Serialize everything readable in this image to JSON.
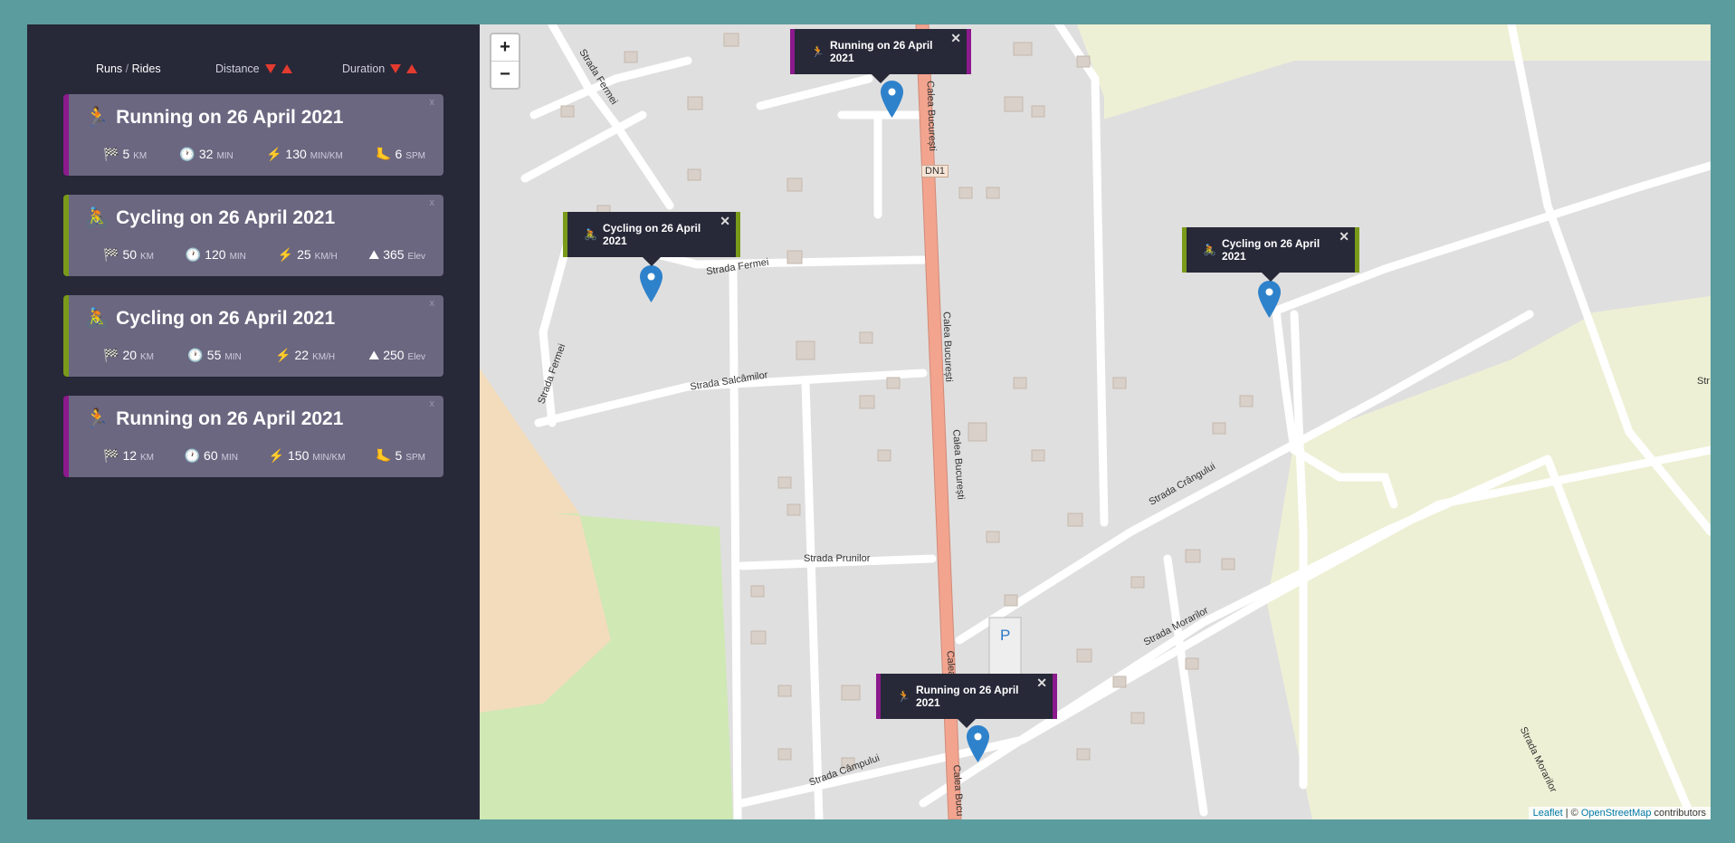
{
  "sidebar": {
    "sort": {
      "runs_label": "Runs",
      "sep": " / ",
      "rides_label": "Rides",
      "distance_label": "Distance",
      "duration_label": "Duration"
    },
    "workouts": [
      {
        "type": "running",
        "title": "Running on 26 April 2021",
        "close": "x",
        "icon": "runner-icon",
        "stats": [
          {
            "icon": "flag-icon",
            "value": "5",
            "unit": "KM"
          },
          {
            "icon": "clock-icon",
            "value": "32",
            "unit": "MIN"
          },
          {
            "icon": "bolt-icon",
            "value": "130",
            "unit": "MIN/KM"
          },
          {
            "icon": "foot-icon",
            "value": "6",
            "unit": "SPM"
          }
        ]
      },
      {
        "type": "cycling",
        "title": "Cycling on 26 April 2021",
        "close": "x",
        "icon": "cyclist-icon",
        "stats": [
          {
            "icon": "flag-icon",
            "value": "50",
            "unit": "KM"
          },
          {
            "icon": "clock-icon",
            "value": "120",
            "unit": "MIN"
          },
          {
            "icon": "bolt-icon",
            "value": "25",
            "unit": "KM/H"
          },
          {
            "icon": "mountain-icon",
            "value": "365",
            "unit": "Elev"
          }
        ]
      },
      {
        "type": "cycling",
        "title": "Cycling on 26 April 2021",
        "close": "x",
        "icon": "cyclist-icon",
        "stats": [
          {
            "icon": "flag-icon",
            "value": "20",
            "unit": "KM"
          },
          {
            "icon": "clock-icon",
            "value": "55",
            "unit": "MIN"
          },
          {
            "icon": "bolt-icon",
            "value": "22",
            "unit": "KM/H"
          },
          {
            "icon": "mountain-icon",
            "value": "250",
            "unit": "Elev"
          }
        ]
      },
      {
        "type": "running",
        "title": "Running on 26 April 2021",
        "close": "x",
        "icon": "runner-icon",
        "stats": [
          {
            "icon": "flag-icon",
            "value": "12",
            "unit": "KM"
          },
          {
            "icon": "clock-icon",
            "value": "60",
            "unit": "MIN"
          },
          {
            "icon": "bolt-icon",
            "value": "150",
            "unit": "MIN/KM"
          },
          {
            "icon": "foot-icon",
            "value": "5",
            "unit": "SPM"
          }
        ]
      }
    ]
  },
  "map": {
    "zoom_in": "+",
    "zoom_out": "−",
    "popups": [
      {
        "type": "running",
        "label": "Running on 26 April 2021",
        "close": "✕"
      },
      {
        "type": "cycling",
        "label": "Cycling on 26 April 2021",
        "close": "✕"
      },
      {
        "type": "cycling",
        "label": "Cycling on 26 April 2021",
        "close": "✕"
      },
      {
        "type": "running",
        "label": "Running on 26 April 2021",
        "close": "✕"
      }
    ],
    "streets": {
      "fermei_1": "Strada Fermei",
      "fermei_2": "Strada Fermei",
      "fermei_3": "Strada Fermei",
      "salcamilor": "Strada Salcâmilor",
      "prunilor": "Strada Prunilor",
      "campului": "Strada Câmpului",
      "crangului": "Strada Crângului",
      "morarilor_1": "Strada Morarilor",
      "morarilor_2": "Strada Morarilor",
      "calea_1": "Calea București",
      "calea_2": "Calea București",
      "calea_3": "Calea București",
      "calea_4": "Calea Bucu",
      "calea_5": "Calea",
      "dn1": "DN1",
      "str_edge": "Str",
      "parking": "P"
    },
    "attribution": {
      "leaflet": "Leaflet",
      "sep": " | © ",
      "osm": "OpenStreetMap",
      "contributors": " contributors"
    },
    "colors": {
      "main_road": "#f2a48f",
      "green_area": "#cfe8b4",
      "farmland": "#eef0d5",
      "sand": "#f3dcbb",
      "marker": "#2e82cb"
    }
  }
}
